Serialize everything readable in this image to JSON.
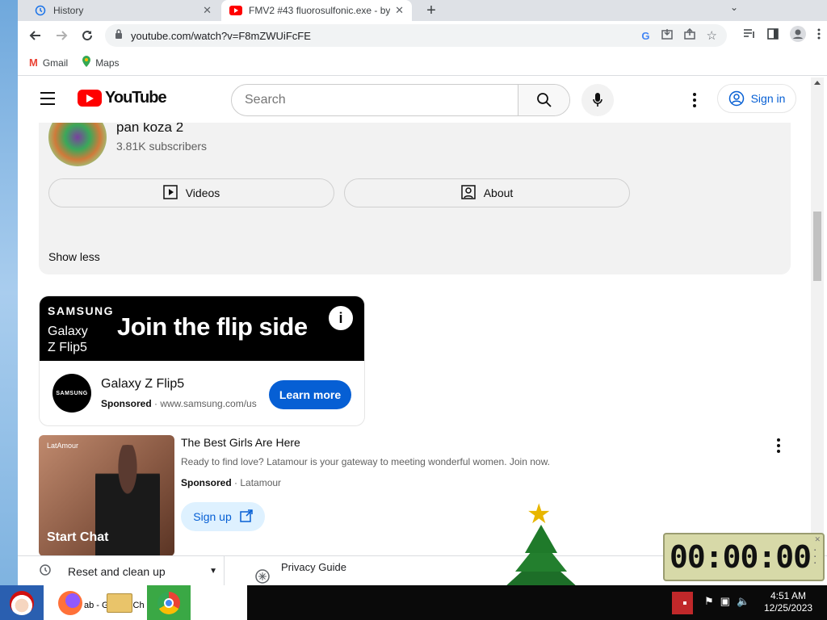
{
  "tabs": [
    {
      "title": "History",
      "icon": "history-icon"
    },
    {
      "title": "FMV2 #43 fluorosulfonic.exe - by",
      "icon": "youtube-favicon"
    }
  ],
  "address_bar": {
    "url": "youtube.com/watch?v=F8mZWUiFcFE"
  },
  "bookmarks": [
    {
      "label": "Gmail",
      "icon": "gmail-icon"
    },
    {
      "label": "Maps",
      "icon": "maps-icon"
    }
  ],
  "youtube": {
    "logo_text": "YouTube",
    "search_placeholder": "Search",
    "signin_label": "Sign in"
  },
  "channel": {
    "name": "pan koza 2",
    "subscribers": "3.81K subscribers",
    "videos_label": "Videos",
    "about_label": "About",
    "show_less": "Show less"
  },
  "ad_samsung": {
    "brand": "SAMSUNG",
    "product_line1": "Galaxy",
    "product_line2": "Z Flip5",
    "slogan": "Join the flip side",
    "logo_text": "SAMSUNG",
    "title": "Galaxy Z Flip5",
    "sponsored": "Sponsored",
    "domain": "www.samsung.com/us",
    "cta": "Learn more"
  },
  "ad_latamour": {
    "thumb_tag": "LatAmour",
    "thumb_text": "Start Chat",
    "title": "The Best Girls Are Here",
    "description": "Ready to find love? Latamour is your gateway to meeting wonderful women. Join now.",
    "sponsored": "Sponsored",
    "advertiser": "Latamour",
    "cta": "Sign up"
  },
  "bottom_popup": {
    "reset_label": "Reset and clean up",
    "privacy_label": "Privacy Guide"
  },
  "clock_widget": {
    "digits": "00:00:00"
  },
  "taskbar": {
    "partial_label": "ab - Google Ch",
    "time": "4:51 AM",
    "date": "12/25/2023"
  },
  "colors": {
    "youtube_red": "#ff0000",
    "link_blue": "#065fd4",
    "desktop_blue": "#3a6ea5"
  }
}
